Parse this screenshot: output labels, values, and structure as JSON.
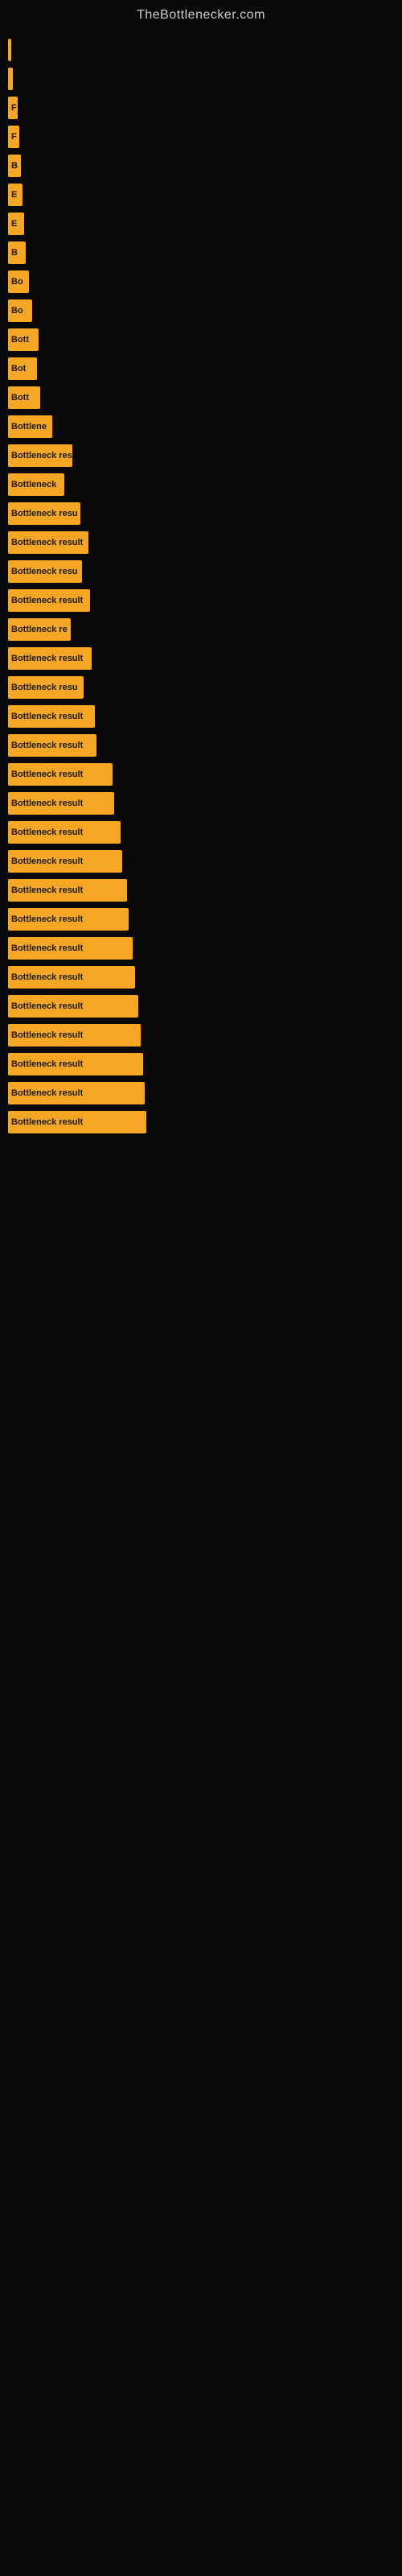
{
  "header": {
    "title": "TheBottlenecker.com"
  },
  "bars": [
    {
      "label": "",
      "width": 4
    },
    {
      "label": "",
      "width": 6
    },
    {
      "label": "F",
      "width": 12
    },
    {
      "label": "F",
      "width": 14
    },
    {
      "label": "B",
      "width": 16
    },
    {
      "label": "E",
      "width": 18
    },
    {
      "label": "E",
      "width": 20
    },
    {
      "label": "B",
      "width": 22
    },
    {
      "label": "Bo",
      "width": 26
    },
    {
      "label": "Bo",
      "width": 30
    },
    {
      "label": "Bott",
      "width": 38
    },
    {
      "label": "Bot",
      "width": 36
    },
    {
      "label": "Bott",
      "width": 40
    },
    {
      "label": "Bottlene",
      "width": 55
    },
    {
      "label": "Bottleneck res",
      "width": 80
    },
    {
      "label": "Bottleneck",
      "width": 70
    },
    {
      "label": "Bottleneck resu",
      "width": 90
    },
    {
      "label": "Bottleneck result",
      "width": 100
    },
    {
      "label": "Bottleneck resu",
      "width": 92
    },
    {
      "label": "Bottleneck result",
      "width": 102
    },
    {
      "label": "Bottleneck re",
      "width": 78
    },
    {
      "label": "Bottleneck result",
      "width": 104
    },
    {
      "label": "Bottleneck resu",
      "width": 94
    },
    {
      "label": "Bottleneck result",
      "width": 108
    },
    {
      "label": "Bottleneck result",
      "width": 110
    },
    {
      "label": "Bottleneck result",
      "width": 130
    },
    {
      "label": "Bottleneck result",
      "width": 132
    },
    {
      "label": "Bottleneck result",
      "width": 140
    },
    {
      "label": "Bottleneck result",
      "width": 142
    },
    {
      "label": "Bottleneck result",
      "width": 148
    },
    {
      "label": "Bottleneck result",
      "width": 150
    },
    {
      "label": "Bottleneck result",
      "width": 155
    },
    {
      "label": "Bottleneck result",
      "width": 158
    },
    {
      "label": "Bottleneck result",
      "width": 162
    },
    {
      "label": "Bottleneck result",
      "width": 165
    },
    {
      "label": "Bottleneck result",
      "width": 168
    },
    {
      "label": "Bottleneck result",
      "width": 170
    },
    {
      "label": "Bottleneck result",
      "width": 172
    }
  ]
}
